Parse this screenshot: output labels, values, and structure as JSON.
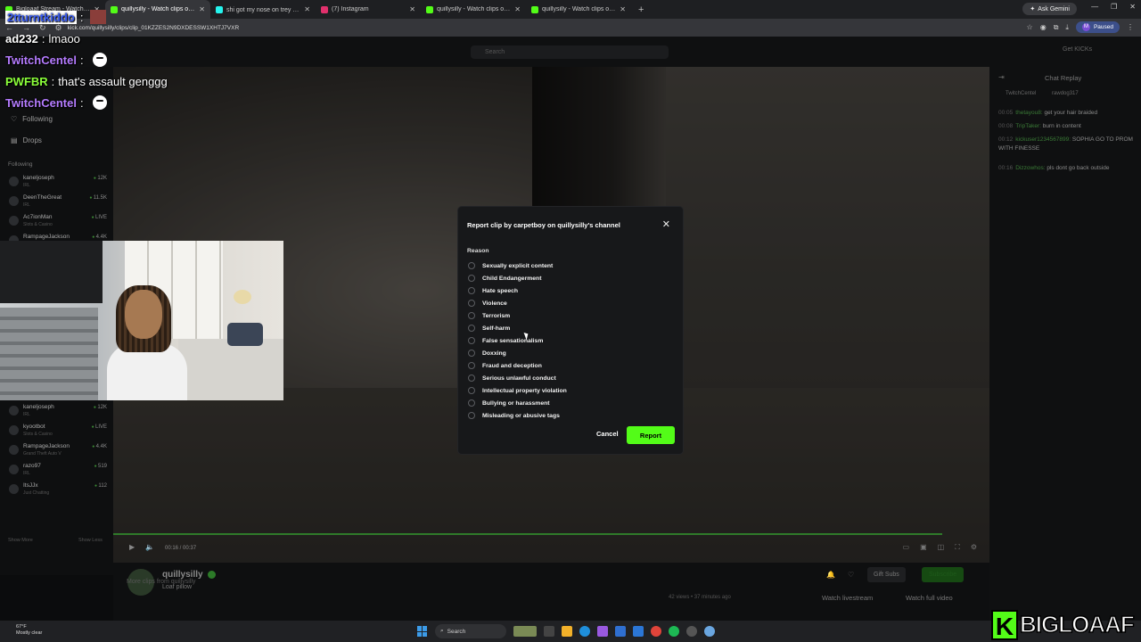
{
  "browser": {
    "tabs": [
      {
        "title": "Bigloaaf Stream - Watch Live",
        "color": "#53fc18"
      },
      {
        "title": "quillysilly - Watch clips on Kick",
        "color": "#53fc18",
        "active": true
      },
      {
        "title": "shi got my nose on trey 😂😂",
        "color": "#25f4ee"
      },
      {
        "title": "(7) Instagram",
        "color": "#e1306c"
      },
      {
        "title": "quillysilly - Watch clips on Kick",
        "color": "#53fc18"
      },
      {
        "title": "quillysilly - Watch clips on Kick",
        "color": "#53fc18"
      }
    ],
    "new_tab": "+",
    "ask_gemini": "Ask Gemini",
    "url": "kick.com/quillysilly/clips/clip_01KZZES2N9DXDESSW1XHTJ7VXR",
    "profile_initial": "M",
    "profile_status": "Paused"
  },
  "site": {
    "search_placeholder": "Search",
    "get_kicks": "Get KICKs",
    "sidebar": {
      "following_label": "Following",
      "drops_label": "Drops",
      "section_following": "Following",
      "channels_top": [
        {
          "name": "kaneljoseph",
          "sub": "IRL",
          "viewers": "12K"
        },
        {
          "name": "DeenTheGreat",
          "sub": "IRL",
          "viewers": "11.5K"
        },
        {
          "name": "Ac7ionMan",
          "sub": "Slots & Casino",
          "viewers": "LIVE"
        },
        {
          "name": "RampageJackson",
          "sub": "",
          "viewers": "4.4K"
        }
      ],
      "channels_bottom": [
        {
          "name": "kaneljoseph",
          "sub": "IRL",
          "viewers": "12K"
        },
        {
          "name": "kyootbot",
          "sub": "Slots & Casino",
          "viewers": "LIVE"
        },
        {
          "name": "RampageJackson",
          "sub": "Grand Theft Auto V",
          "viewers": "4.4K"
        },
        {
          "name": "razo97",
          "sub": "IRL",
          "viewers": "519"
        },
        {
          "name": "ItsJJx",
          "sub": "Just Chatting",
          "viewers": "112"
        }
      ],
      "show_more": "Show More",
      "show_less": "Show Less"
    },
    "player": {
      "time": "00:16 / 00:37",
      "progress": 0.946
    },
    "chat": {
      "title": "Chat Replay",
      "pinned": [
        "TwitchCentel",
        "rawdog317"
      ],
      "messages": [
        {
          "time": "00:05",
          "user": "thetayou8:",
          "text": "get your hair braided"
        },
        {
          "time": "00:08",
          "user": "TripTaker:",
          "text": "burn in content"
        },
        {
          "time": "00:12",
          "user": "kickuser1234567899:",
          "text": "SOPHIA GO TO PROM WITH FINESSE"
        },
        {
          "time": "00:16",
          "user": "Dizzowhos:",
          "text": "pls dont go back outside"
        }
      ]
    },
    "channel": {
      "name": "quillysilly",
      "clip_title": "Loaf pillow",
      "views": "42 views • 37 minutes ago",
      "gift_subs": "Gift Subs",
      "subscribe": "Subscribe",
      "watch_livestream": "Watch livestream",
      "watch_full_video": "Watch full video",
      "more_clips": "More clips from quillysilly"
    }
  },
  "modal": {
    "title": "Report clip by carpetboy on quillysilly's channel",
    "reason_label": "Reason",
    "options": [
      "Sexually explicit content",
      "Child Endangerment",
      "Hate speech",
      "Violence",
      "Terrorism",
      "Self-harm",
      "False sensationalism",
      "Doxxing",
      "Fraud and deception",
      "Serious unlawful conduct",
      "Intellectual property violation",
      "Bullying or harassment",
      "Misleading or abusive tags"
    ],
    "cancel": "Cancel",
    "report": "Report",
    "accent_color": "#53fc18"
  },
  "overlay_chat": [
    {
      "user": "2tturntkiddo",
      "sep": ":",
      "text": "",
      "color": "#4a6cff",
      "emote": "red"
    },
    {
      "user": "ad232",
      "sep": ":",
      "text": "lmaoo",
      "color": "#ffffff",
      "emote": ""
    },
    {
      "user": "TwitchCentel",
      "sep": ":",
      "text": "",
      "color": "#b57cff",
      "emote": "white"
    },
    {
      "user": "PWFBR",
      "sep": ":",
      "text": "that's assault genggg",
      "color": "#8bff3a",
      "emote": ""
    },
    {
      "user": "TwitchCentel",
      "sep": ":",
      "text": "",
      "color": "#b57cff",
      "emote": "white"
    }
  ],
  "taskbar": {
    "weather_temp": "67°F",
    "weather_desc": "Mostly clear",
    "search": "Search"
  },
  "watermark": {
    "letter": "K",
    "text": "BIGLOAAF"
  }
}
